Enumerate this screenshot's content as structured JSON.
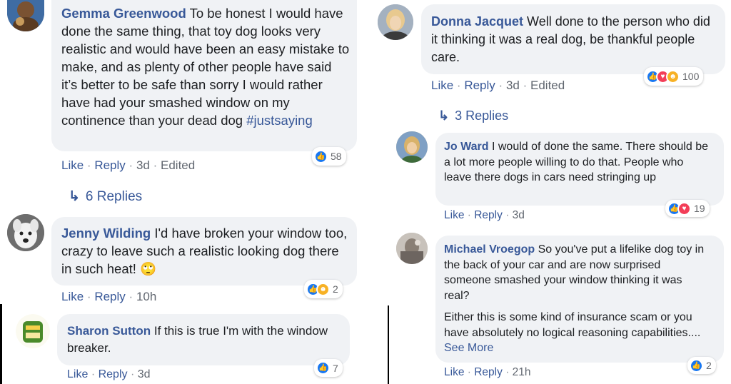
{
  "left": {
    "c1": {
      "author": "Gemma Greenwood",
      "text": "To be honest I would have done the same thing, that toy dog looks very realistic and would have been an easy mistake to make, and as plenty of other people have said it’s better to be safe than sorry I would rather have had your smashed window on my continence than your dead dog ",
      "hashtag": "#justsaying",
      "like": "Like",
      "reply": "Reply",
      "time": "3d",
      "edited": "Edited",
      "react_count": "58",
      "replies": "6 Replies"
    },
    "c2": {
      "author": "Jenny Wilding",
      "text": "I'd have broken your window too, crazy to leave such a realistic looking dog there in such heat!",
      "emoji": "🙄",
      "like": "Like",
      "reply": "Reply",
      "time": "10h",
      "react_count": "2"
    },
    "c3": {
      "author": "Sharon Sutton",
      "text": "If this is true I'm with the window breaker.",
      "like": "Like",
      "reply": "Reply",
      "time": "3d",
      "react_count": "7"
    }
  },
  "right": {
    "c1": {
      "author": "Donna Jacquet",
      "text": "Well done to the person who did it thinking it was a real dog, be thankful people care.",
      "like": "Like",
      "reply": "Reply",
      "time": "3d",
      "edited": "Edited",
      "react_count": "100",
      "replies": "3 Replies"
    },
    "c2": {
      "author": "Jo Ward",
      "text": "I would of done the same. There should be a lot more people willing to do that. People who leave there dogs in cars need stringing up",
      "like": "Like",
      "reply": "Reply",
      "time": "3d",
      "react_count": "19"
    },
    "c3": {
      "author": "Michael Vroegop",
      "text": "So you've put a lifelike dog toy in the back of your car and are now surprised someone smashed your window thinking it was real?",
      "text2": "Either this is some kind of insurance scam or you have absolutely no logical reasoning capabilities.... ",
      "see_more": "See More",
      "like": "Like",
      "reply": "Reply",
      "time": "21h",
      "react_count": "2"
    }
  },
  "separator": "·",
  "icons": [
    "like-reaction-icon",
    "love-reaction-icon",
    "haha-reaction-icon",
    "reply-arrow-icon"
  ],
  "colors": {
    "link": "#385898",
    "bubble": "#f0f2f5",
    "like": "#1877f2",
    "love": "#f33e58",
    "haha": "#f7b125"
  }
}
